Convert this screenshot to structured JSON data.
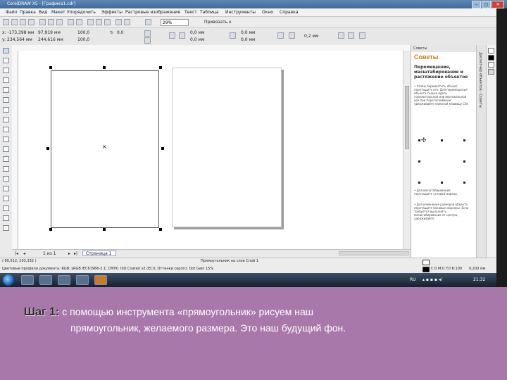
{
  "window": {
    "title": "CorelDRAW X5 - [Графика1.cdr]",
    "controls": [
      "–",
      "□",
      "✕"
    ]
  },
  "menu": [
    "Файл",
    "Правка",
    "Вид",
    "Макет",
    "Упорядочить",
    "Эффекты",
    "Растровые изображения",
    "Текст",
    "Таблица",
    "Инструменты",
    "Окно",
    "Справка"
  ],
  "toolbar": {
    "zoom": "29%",
    "snap_label": "Привязать к"
  },
  "propbar": {
    "x": "x: -173,398 мм",
    "y": "y: 234,564 мм",
    "w": "97,919 мм",
    "h": "244,616 мм",
    "sx": "100,0",
    "sy": "100,0",
    "angle": "0,0",
    "corner1": "0,0 мм",
    "corner2": "0,0 мм",
    "outline": "0,2 мм"
  },
  "docker": {
    "header": "Советы",
    "title": "Советы",
    "subtitle": "Перемещение, масштабирование и растяжение объектов",
    "text1": "• Чтобы переместить объект, перетащите его. Для перемещения объекта только вдоль горизонтальной или вертикальной оси при перетаскивании удерживайте нажатой клавишу Ctrl.",
    "text2": "• Для масштабирования перетащите угловой маркер.",
    "text3": "• Для изменения размеров объекта перетащите боковые маркеры. Если требуется выполнить масштабирование от центра, удерживайте",
    "strip_label": "Диспетчер объектов · Советы"
  },
  "pagebar": {
    "pages": "1 из 1",
    "tab": "Страница 1"
  },
  "statusbar": {
    "coords": "( 80,512; 203,332 )",
    "object_info": "Прямоугольник на слое Слой 1",
    "color_profile": "Цветовые профили документа: RGB: sRGB IEC61966-2.1; CMYK: ISO Coated v2 (ECI); Оттенки серого: Dot Gain 15%",
    "fill_value": "C:0 M:0 Y:0 K:100",
    "outline_value": "0,200 мм"
  },
  "taskbar": {
    "lang": "RU",
    "time": "21:32"
  },
  "caption": {
    "step": "Шаг 1:",
    "line1": "с помощью инструмента «прямоугольник» рисуем наш",
    "line2": "прямоугольник, желаемого размера. Это наш будущий фон."
  }
}
